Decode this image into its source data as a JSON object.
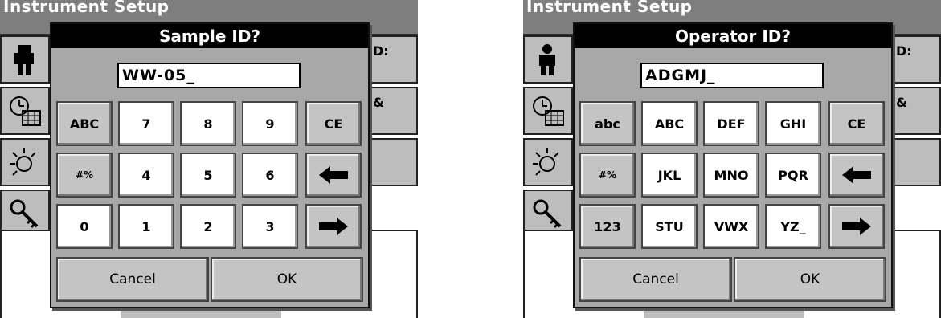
{
  "background": {
    "title": "Instrument Setup",
    "right_labels": [
      "D:",
      "&"
    ]
  },
  "dialogs": [
    {
      "title": "Sample ID?",
      "entry_value": "WW-05_",
      "rows": [
        [
          "ABC",
          "7",
          "8",
          "9",
          "CE"
        ],
        [
          "#%",
          "4",
          "5",
          "6",
          "back-arrow"
        ],
        [
          "0",
          "1",
          "2",
          "3",
          "forward-arrow"
        ]
      ],
      "cancel": "Cancel",
      "ok": "OK"
    },
    {
      "title": "Operator ID?",
      "entry_value": "ADGMJ_",
      "rows": [
        [
          "abc",
          "ABC",
          "DEF",
          "GHI",
          "CE"
        ],
        [
          "#%",
          "JKL",
          "MNO",
          "PQR",
          "back-arrow"
        ],
        [
          "123",
          "STU",
          "VWX",
          "YZ_",
          "forward-arrow"
        ]
      ],
      "cancel": "Cancel",
      "ok": "OK"
    }
  ],
  "icons": [
    "operator-icon",
    "clock-calendar-icon",
    "lamp-icon",
    "key-icon"
  ]
}
